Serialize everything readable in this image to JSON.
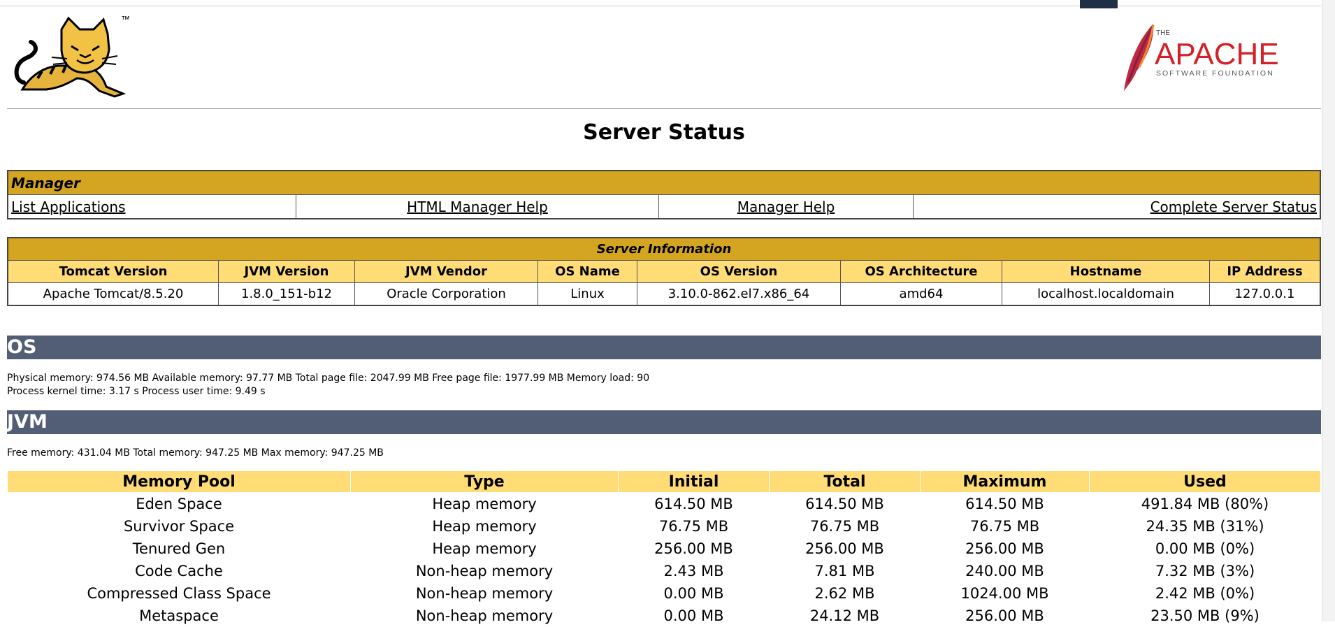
{
  "page": {
    "title": "Server Status"
  },
  "branding": {
    "tomcat_tm": "™",
    "apache_small": "THE",
    "apache_name": "APACHE",
    "apache_sub": "SOFTWARE FOUNDATION"
  },
  "manager": {
    "heading": "Manager",
    "links": [
      "List Applications",
      "HTML Manager Help",
      "Manager Help",
      "Complete Server Status"
    ]
  },
  "server_info": {
    "heading": "Server Information",
    "columns": [
      "Tomcat Version",
      "JVM Version",
      "JVM Vendor",
      "OS Name",
      "OS Version",
      "OS Architecture",
      "Hostname",
      "IP Address"
    ],
    "values": [
      "Apache Tomcat/8.5.20",
      "1.8.0_151-b12",
      "Oracle Corporation",
      "Linux",
      "3.10.0-862.el7.x86_64",
      "amd64",
      "localhost.localdomain",
      "127.0.0.1"
    ]
  },
  "os": {
    "heading": "OS",
    "line1": "Physical memory: 974.56 MB Available memory: 97.77 MB Total page file: 2047.99 MB Free page file: 1977.99 MB Memory load: 90",
    "line2": "Process kernel time: 3.17 s Process user time: 9.49 s"
  },
  "jvm": {
    "heading": "JVM",
    "line1": "Free memory: 431.04 MB Total memory: 947.25 MB Max memory: 947.25 MB",
    "columns": [
      "Memory Pool",
      "Type",
      "Initial",
      "Total",
      "Maximum",
      "Used"
    ],
    "rows": [
      [
        "Eden Space",
        "Heap memory",
        "614.50 MB",
        "614.50 MB",
        "614.50 MB",
        "491.84 MB (80%)"
      ],
      [
        "Survivor Space",
        "Heap memory",
        "76.75 MB",
        "76.75 MB",
        "76.75 MB",
        "24.35 MB (31%)"
      ],
      [
        "Tenured Gen",
        "Heap memory",
        "256.00 MB",
        "256.00 MB",
        "256.00 MB",
        "0.00 MB (0%)"
      ],
      [
        "Code Cache",
        "Non-heap memory",
        "2.43 MB",
        "7.81 MB",
        "240.00 MB",
        "7.32 MB (3%)"
      ],
      [
        "Compressed Class Space",
        "Non-heap memory",
        "0.00 MB",
        "2.62 MB",
        "1024.00 MB",
        "2.42 MB (0%)"
      ],
      [
        "Metaspace",
        "Non-heap memory",
        "0.00 MB",
        "24.12 MB",
        "256.00 MB",
        "23.50 MB (9%)"
      ]
    ]
  },
  "colors": {
    "manager_head": "#d4a520",
    "col_head": "#ffdc75",
    "section_bar": "#525d76",
    "apache_red": "#d22128"
  }
}
